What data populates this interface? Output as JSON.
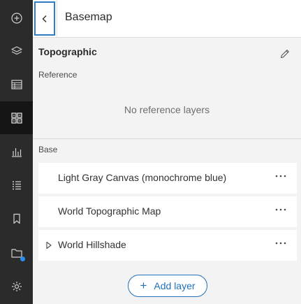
{
  "toolbar": {
    "items": [
      {
        "icon": "add-circle-icon"
      },
      {
        "icon": "layers-icon"
      },
      {
        "icon": "table-icon"
      },
      {
        "icon": "basemap-gallery-icon",
        "active": true
      },
      {
        "icon": "chart-icon"
      },
      {
        "icon": "legend-icon"
      },
      {
        "icon": "bookmark-icon"
      },
      {
        "icon": "map-folder-icon",
        "badge_color": "#2a8ff0"
      },
      {
        "icon": "settings-icon"
      }
    ]
  },
  "header": {
    "back_icon": "chevron-left-icon",
    "title": "Basemap"
  },
  "basemap": {
    "name": "Topographic",
    "edit_icon": "pencil-icon",
    "reference_label": "Reference",
    "reference_empty": "No reference layers",
    "base_label": "Base",
    "layers": [
      {
        "label": "Light Gray Canvas (monochrome blue)",
        "expandable": false
      },
      {
        "label": "World Topographic Map",
        "expandable": false
      },
      {
        "label": "World Hillshade",
        "expandable": true
      }
    ],
    "more_icon": "more-options-icon",
    "add_layer": "Add layer"
  },
  "colors": {
    "toolbar_bg": "#2b2b2b",
    "accent": "#1f70b8",
    "panel_bg": "#f3f3f3"
  }
}
